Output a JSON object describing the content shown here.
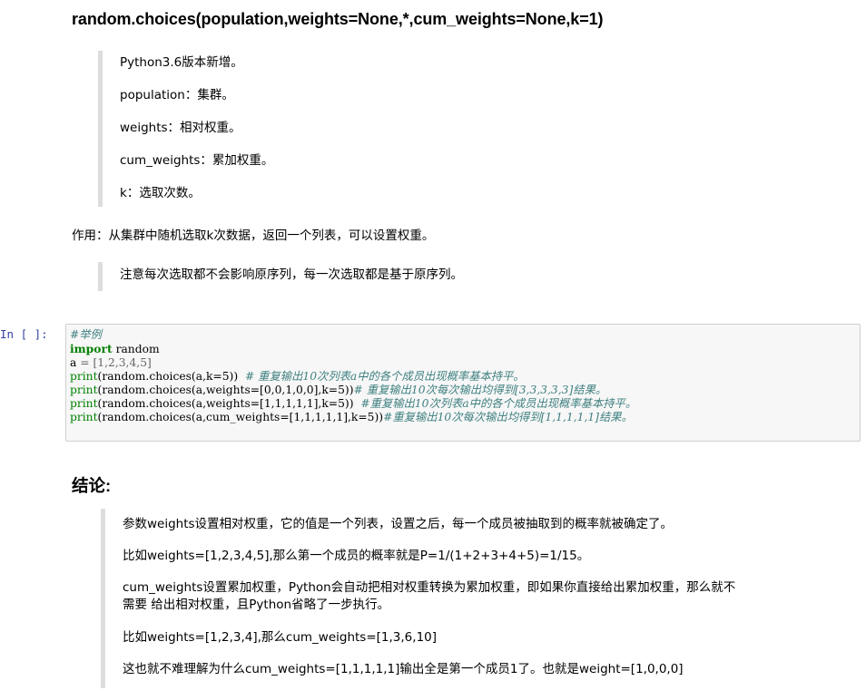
{
  "section": {
    "signature": "random.choices(population,weights=None,*,cum_weights=None,k=1)",
    "params": [
      "Python3.6版本新增。",
      "population：集群。",
      "weights：相对权重。",
      "cum_weights：累加权重。",
      "k：选取次数。"
    ],
    "effect": "作用：从集群中随机选取k次数据，返回一个列表，可以设置权重。",
    "note": "注意每次选取都不会影响原序列，每一次选取都是基于原序列。"
  },
  "cell": {
    "prompt": "In [ ]:",
    "code": {
      "line1_comment": "#举例",
      "line2_kw": "import",
      "line2_rest": " random",
      "line3": {
        "var": "a",
        "eq": " = ",
        "list": "[1,2,3,4,5]"
      },
      "print_kw": "print",
      "line4_code": "(random.choices(a,k=5))",
      "line4_comment": "  # 重复输出10次列表a中的各个成员出现概率基本持平。",
      "line5_code": "(random.choices(a,weights=[0,0,1,0,0],k=5))",
      "line5_comment": "# 重复输出10次每次输出均得到[3,3,3,3,3]结果。",
      "line6_code": "(random.choices(a,weights=[1,1,1,1,1],k=5))",
      "line6_comment": "  #重复输出10次列表a中的各个成员出现概率基本持平。",
      "line7_code": "(random.choices(a,cum_weights=[1,1,1,1,1],k=5))",
      "line7_comment": "#重复输出10次每次输出均得到[1,1,1,1,1]结果。"
    }
  },
  "conclusion": {
    "heading": "结论:",
    "items": [
      "参数weights设置相对权重，它的值是一个列表，设置之后，每一个成员被抽取到的概率就被确定了。",
      "比如weights=[1,2,3,4,5],那么第一个成员的概率就是P=1/(1+2+3+4+5)=1/15。",
      "cum_weights设置累加权重，Python会自动把相对权重转换为累加权重，即如果你直接给出累加权重，那么就不",
      "需要 给出相对权重，且Python省略了一步执行。",
      "比如weights=[1,2,3,4],那么cum_weights=[1,3,6,10]",
      "这也就不难理解为什么cum_weights=[1,1,1,1,1]输出全是第一个成员1了。也就是weight=[1,0,0,0]"
    ]
  }
}
